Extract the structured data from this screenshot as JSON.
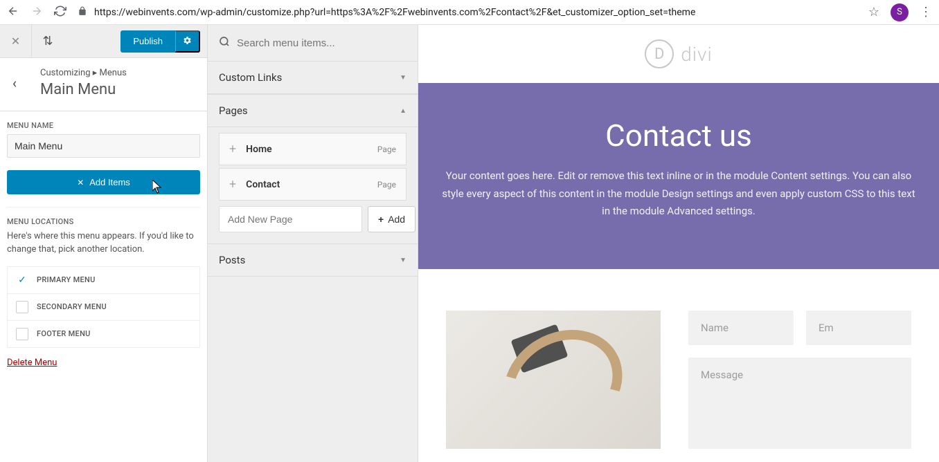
{
  "browser": {
    "url": "https://webinvents.com/wp-admin/customize.php?url=https%3A%2F%2Fwebinvents.com%2Fcontact%2F&et_customizer_option_set=theme",
    "avatar_letter": "S"
  },
  "sidebar": {
    "publish": "Publish",
    "breadcrumb_pre": "Customizing",
    "breadcrumb_link": "Menus",
    "section_title": "Main Menu",
    "menu_name_label": "MENU NAME",
    "menu_name_value": "Main Menu",
    "add_items": "Add Items",
    "menu_locations_label": "MENU LOCATIONS",
    "locations_desc": "Here's where this menu appears. If you'd like to change that, pick another location.",
    "locations": [
      {
        "label": "PRIMARY MENU",
        "checked": true
      },
      {
        "label": "SECONDARY MENU",
        "checked": false
      },
      {
        "label": "FOOTER MENU",
        "checked": false
      }
    ],
    "delete_menu": "Delete Menu"
  },
  "middle": {
    "search_placeholder": "Search menu items...",
    "custom_links": "Custom Links",
    "pages": "Pages",
    "page_items": [
      {
        "name": "Home",
        "type": "Page"
      },
      {
        "name": "Contact",
        "type": "Page"
      }
    ],
    "add_new_placeholder": "Add New Page",
    "add_btn": "Add",
    "posts": "Posts"
  },
  "preview": {
    "logo_text": "divi",
    "logo_letter": "D",
    "hero_title": "Contact us",
    "hero_desc": "Your content goes here. Edit or remove this text inline or in the module Content settings. You can also style every aspect of this content in the module Design settings and even apply custom CSS to this text in the module Advanced settings.",
    "name_placeholder": "Name",
    "email_placeholder": "Em",
    "message_placeholder": "Message"
  }
}
